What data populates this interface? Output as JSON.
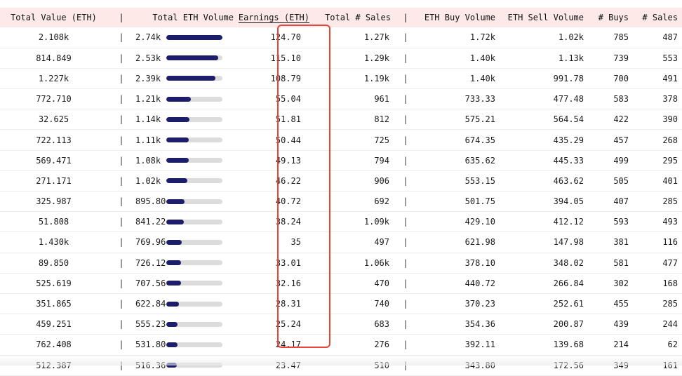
{
  "headers": {
    "total_value": "Total Value (ETH)",
    "sep1": "|",
    "total_volume": "Total ETH Volume",
    "earnings": "Earnings (ETH)",
    "total_sales": "Total # Sales",
    "sep2": "|",
    "buy_volume": "ETH Buy Volume",
    "sell_volume": "ETH Sell Volume",
    "buys": "# Buys",
    "sales": "# Sales"
  },
  "rows": [
    {
      "total_value": "2.108k",
      "sep1": "|",
      "volume": "2.74k",
      "volume_fraction": 1.0,
      "earnings": "124.70",
      "total_sales": "1.27k",
      "sep2": "|",
      "buy_volume": "1.72k",
      "sell_volume": "1.02k",
      "buys": "785",
      "sales": "487"
    },
    {
      "total_value": "814.849",
      "sep1": "|",
      "volume": "2.53k",
      "volume_fraction": 0.923,
      "earnings": "115.10",
      "total_sales": "1.29k",
      "sep2": "|",
      "buy_volume": "1.40k",
      "sell_volume": "1.13k",
      "buys": "739",
      "sales": "553"
    },
    {
      "total_value": "1.227k",
      "sep1": "|",
      "volume": "2.39k",
      "volume_fraction": 0.872,
      "earnings": "108.79",
      "total_sales": "1.19k",
      "sep2": "|",
      "buy_volume": "1.40k",
      "sell_volume": "991.78",
      "buys": "700",
      "sales": "491"
    },
    {
      "total_value": "772.710",
      "sep1": "|",
      "volume": "1.21k",
      "volume_fraction": 0.442,
      "earnings": "55.04",
      "total_sales": "961",
      "sep2": "|",
      "buy_volume": "733.33",
      "sell_volume": "477.48",
      "buys": "583",
      "sales": "378"
    },
    {
      "total_value": "32.625",
      "sep1": "|",
      "volume": "1.14k",
      "volume_fraction": 0.416,
      "earnings": "51.81",
      "total_sales": "812",
      "sep2": "|",
      "buy_volume": "575.21",
      "sell_volume": "564.54",
      "buys": "422",
      "sales": "390"
    },
    {
      "total_value": "722.113",
      "sep1": "|",
      "volume": "1.11k",
      "volume_fraction": 0.405,
      "earnings": "50.44",
      "total_sales": "725",
      "sep2": "|",
      "buy_volume": "674.35",
      "sell_volume": "435.29",
      "buys": "457",
      "sales": "268"
    },
    {
      "total_value": "569.471",
      "sep1": "|",
      "volume": "1.08k",
      "volume_fraction": 0.394,
      "earnings": "49.13",
      "total_sales": "794",
      "sep2": "|",
      "buy_volume": "635.62",
      "sell_volume": "445.33",
      "buys": "499",
      "sales": "295"
    },
    {
      "total_value": "271.171",
      "sep1": "|",
      "volume": "1.02k",
      "volume_fraction": 0.372,
      "earnings": "46.22",
      "total_sales": "906",
      "sep2": "|",
      "buy_volume": "553.15",
      "sell_volume": "463.62",
      "buys": "505",
      "sales": "401"
    },
    {
      "total_value": "325.987",
      "sep1": "|",
      "volume": "895.80",
      "volume_fraction": 0.327,
      "earnings": "40.72",
      "total_sales": "692",
      "sep2": "|",
      "buy_volume": "501.75",
      "sell_volume": "394.05",
      "buys": "407",
      "sales": "285"
    },
    {
      "total_value": "51.808",
      "sep1": "|",
      "volume": "841.22",
      "volume_fraction": 0.307,
      "earnings": "38.24",
      "total_sales": "1.09k",
      "sep2": "|",
      "buy_volume": "429.10",
      "sell_volume": "412.12",
      "buys": "593",
      "sales": "493"
    },
    {
      "total_value": "1.430k",
      "sep1": "|",
      "volume": "769.96",
      "volume_fraction": 0.281,
      "earnings": "35",
      "total_sales": "497",
      "sep2": "|",
      "buy_volume": "621.98",
      "sell_volume": "147.98",
      "buys": "381",
      "sales": "116"
    },
    {
      "total_value": "89.850",
      "sep1": "|",
      "volume": "726.12",
      "volume_fraction": 0.265,
      "earnings": "33.01",
      "total_sales": "1.06k",
      "sep2": "|",
      "buy_volume": "378.10",
      "sell_volume": "348.02",
      "buys": "581",
      "sales": "477"
    },
    {
      "total_value": "525.619",
      "sep1": "|",
      "volume": "707.56",
      "volume_fraction": 0.258,
      "earnings": "32.16",
      "total_sales": "470",
      "sep2": "|",
      "buy_volume": "440.72",
      "sell_volume": "266.84",
      "buys": "302",
      "sales": "168"
    },
    {
      "total_value": "351.865",
      "sep1": "|",
      "volume": "622.84",
      "volume_fraction": 0.227,
      "earnings": "28.31",
      "total_sales": "740",
      "sep2": "|",
      "buy_volume": "370.23",
      "sell_volume": "252.61",
      "buys": "455",
      "sales": "285"
    },
    {
      "total_value": "459.251",
      "sep1": "|",
      "volume": "555.23",
      "volume_fraction": 0.203,
      "earnings": "25.24",
      "total_sales": "683",
      "sep2": "|",
      "buy_volume": "354.36",
      "sell_volume": "200.87",
      "buys": "439",
      "sales": "244"
    },
    {
      "total_value": "762.408",
      "sep1": "|",
      "volume": "531.80",
      "volume_fraction": 0.194,
      "earnings": "24.17",
      "total_sales": "276",
      "sep2": "|",
      "buy_volume": "392.11",
      "sell_volume": "139.68",
      "buys": "214",
      "sales": "62"
    },
    {
      "total_value": "512.387",
      "sep1": "|",
      "volume": "516.36",
      "volume_fraction": 0.188,
      "earnings": "23.47",
      "total_sales": "510",
      "sep2": "|",
      "buy_volume": "343.80",
      "sell_volume": "172.56",
      "buys": "349",
      "sales": "161"
    }
  ],
  "colors": {
    "header_bg": "#fce9e8",
    "bar_fill": "#1c1d6b",
    "bar_track": "#dcdcdc",
    "highlight": "#e5473a"
  }
}
